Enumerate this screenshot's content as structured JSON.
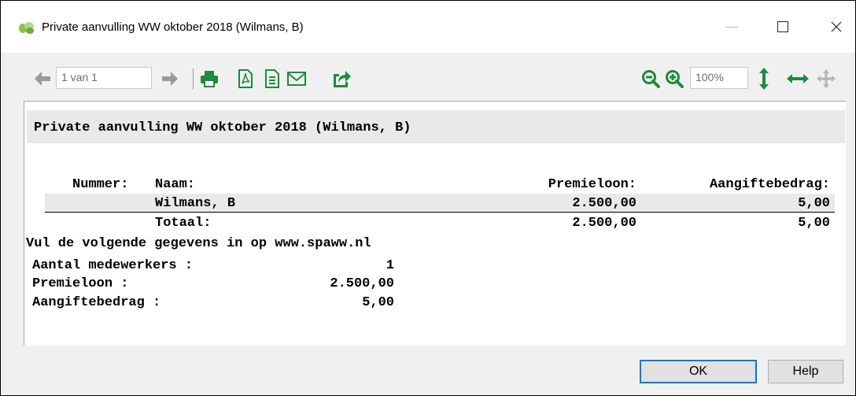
{
  "window": {
    "title": "Private aanvulling WW oktober 2018 (Wilmans, B)"
  },
  "toolbar": {
    "page_indicator": "1 van 1",
    "zoom_level": "100%",
    "icons": [
      "arrow-left-icon",
      "arrow-right-icon",
      "print-icon",
      "pdf-icon",
      "document-icon",
      "mail-icon",
      "export-icon",
      "zoom-out-icon",
      "zoom-in-icon",
      "fit-height-icon",
      "fit-width-icon",
      "pan-icon"
    ]
  },
  "report": {
    "title": "Private aanvulling WW oktober 2018 (Wilmans, B)",
    "columns": {
      "nummer": "Nummer:",
      "naam": "Naam:",
      "premieloon": "Premieloon:",
      "aangiftebedrag": "Aangiftebedrag:"
    },
    "rows": [
      {
        "naam": "Wilmans, B",
        "premieloon": "2.500,00",
        "aangiftebedrag": "5,00"
      }
    ],
    "total": {
      "label": "Totaal:",
      "premieloon": "2.500,00",
      "aangiftebedrag": "5,00"
    },
    "instruction": "Vul de volgende gegevens in op www.spaww.nl",
    "summary": [
      {
        "label": "Aantal medewerkers :",
        "value": "1"
      },
      {
        "label": "Premieloon :",
        "value": "2.500,00"
      },
      {
        "label": "Aangiftebedrag :",
        "value": "5,00"
      }
    ]
  },
  "buttons": {
    "ok": "OK",
    "help": "Help"
  },
  "colors": {
    "toolbar_green": "#1e8a3c",
    "disabled_gray": "#9a9a9a",
    "focus_blue": "#0078d7"
  }
}
